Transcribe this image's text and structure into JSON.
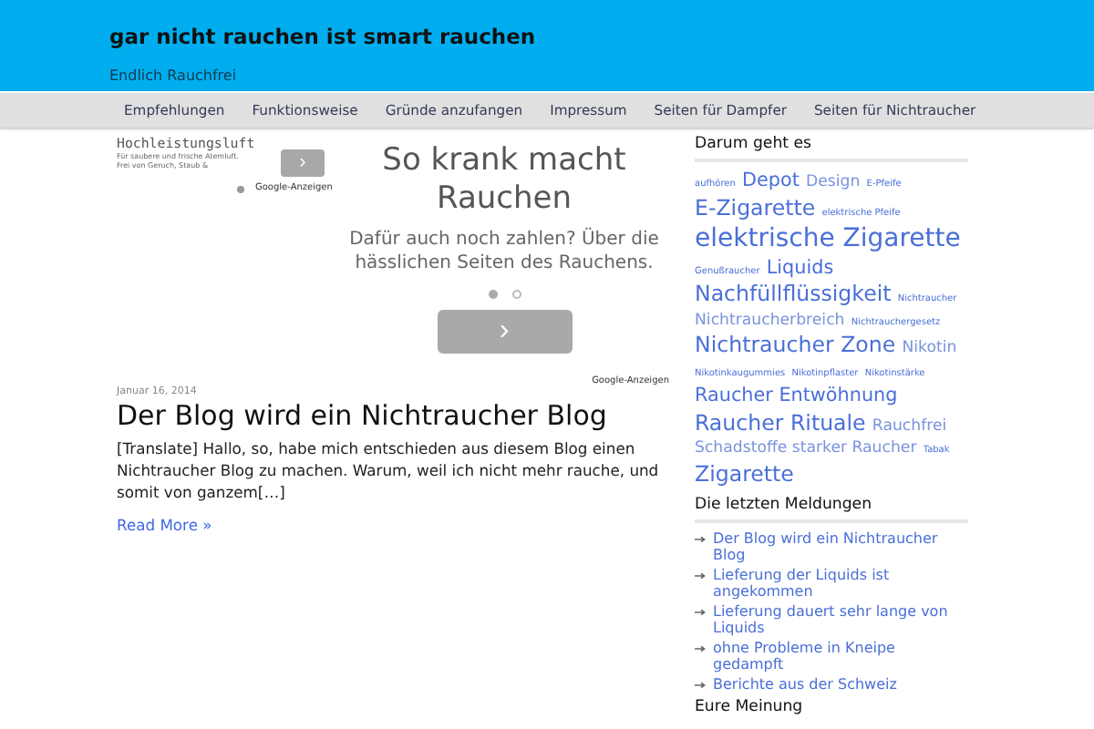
{
  "header": {
    "title": "gar nicht rauchen ist smart rauchen",
    "tagline": "Endlich Rauchfrei"
  },
  "nav": [
    "Empfehlungen",
    "Funktionsweise",
    "Gründe anzufangen",
    "Impressum",
    "Seiten für Dampfer",
    "Seiten für Nichtraucher"
  ],
  "small_ad": {
    "title": "Hochleistungsluft",
    "lines": [
      "Für saubere und frische Atemluft.",
      "Frei von Geruch, Staub &"
    ],
    "button": "›",
    "attribution": "Google-Anzeigen"
  },
  "main_ad": {
    "headline": "So krank macht Rauchen",
    "text": "Dafür auch noch zahlen? Über die hässlichen Seiten des Rauchens.",
    "dots": [
      {
        "selected": true
      },
      {
        "selected": false
      }
    ],
    "button": "›",
    "attribution": "Google-Anzeigen"
  },
  "post": {
    "date": "Januar 16, 2014",
    "title": "Der Blog wird ein Nichtraucher Blog",
    "excerpt": "[Translate] Hallo, so, habe mich entschieden aus diesem Blog einen Nichtraucher Blog zu machen. Warum, weil ich nicht mehr rauche, und somit von ganzem[…]",
    "more": "Read More »"
  },
  "tag_widget": {
    "title": "Darum geht es",
    "tags": [
      {
        "label": "aufhören",
        "kind": "tiny"
      },
      {
        "label": "Depot",
        "kind": "large"
      },
      {
        "label": "Design",
        "kind": "medium"
      },
      {
        "label": "E-Pfeife",
        "kind": "tiny"
      },
      {
        "label": "E-Zigarette",
        "kind": "xlarge"
      },
      {
        "label": "elektrische Pfeife",
        "kind": "tiny"
      },
      {
        "label": "elektrische Zigarette",
        "kind": "huge"
      },
      {
        "label": "Genußraucher",
        "kind": "tiny"
      },
      {
        "label": "Liquids",
        "kind": "large"
      },
      {
        "label": "Nachfüllflüssigkeit",
        "kind": "xlarge"
      },
      {
        "label": "Nichtraucher",
        "kind": "tiny"
      },
      {
        "label": "Nichtraucherbreich",
        "kind": "medium"
      },
      {
        "label": "Nichtrauchergesetz",
        "kind": "tiny"
      },
      {
        "label": "Nichtraucher Zone",
        "kind": "xlarge"
      },
      {
        "label": "Nikotin",
        "kind": "medium"
      },
      {
        "label": "Nikotinkaugummies",
        "kind": "tiny"
      },
      {
        "label": "Nikotinpflaster",
        "kind": "tiny"
      },
      {
        "label": "Nikotinstärke",
        "kind": "tiny"
      },
      {
        "label": "Raucher Entwöhnung",
        "kind": "large"
      },
      {
        "label": "Raucher Rituale",
        "kind": "xlarge"
      },
      {
        "label": "Rauchfrei",
        "kind": "medium"
      },
      {
        "label": "Schadstoffe starker Raucher",
        "kind": "medium"
      },
      {
        "label": "Tabak",
        "kind": "tiny"
      },
      {
        "label": "Zigarette",
        "kind": "xlarge"
      }
    ]
  },
  "recent_widget": {
    "title": "Die letzten Meldungen",
    "items": [
      "Der Blog wird ein Nichtraucher Blog",
      "Lieferung der Liquids ist angekommen",
      "Lieferung dauert sehr lange von Liquids",
      "ohne Probleme in Kneipe gedampft",
      "Berichte aus der Schweiz"
    ]
  },
  "comments_widget": {
    "title": "Eure Meinung"
  }
}
